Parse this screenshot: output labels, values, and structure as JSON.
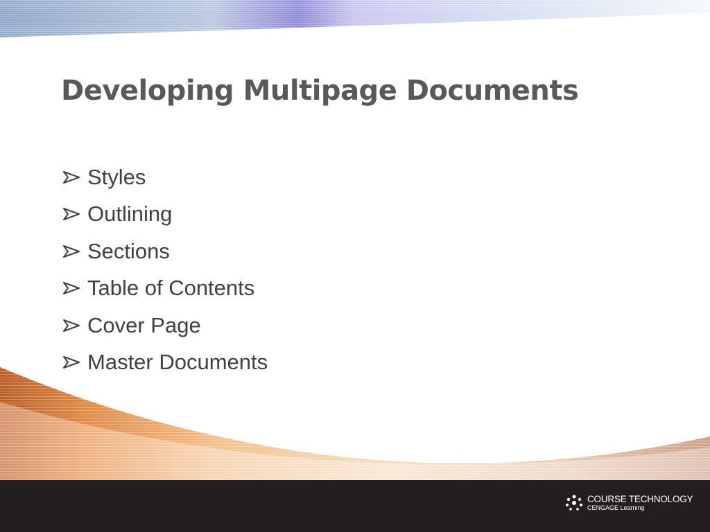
{
  "slide": {
    "title": "Developing Multipage Documents",
    "bullets": [
      "Styles",
      "Outlining",
      "Sections",
      "Table of Contents",
      "Cover Page",
      "Master Documents"
    ]
  },
  "footer": {
    "logo_line1": "COURSE TECHNOLOGY",
    "logo_line2": "CENGAGE Learning"
  },
  "colors": {
    "title": "#595959",
    "body_text": "#404040",
    "footer_bg": "#231f20",
    "accent_orange": "#e8893a",
    "accent_purple": "#8e8ad8"
  }
}
